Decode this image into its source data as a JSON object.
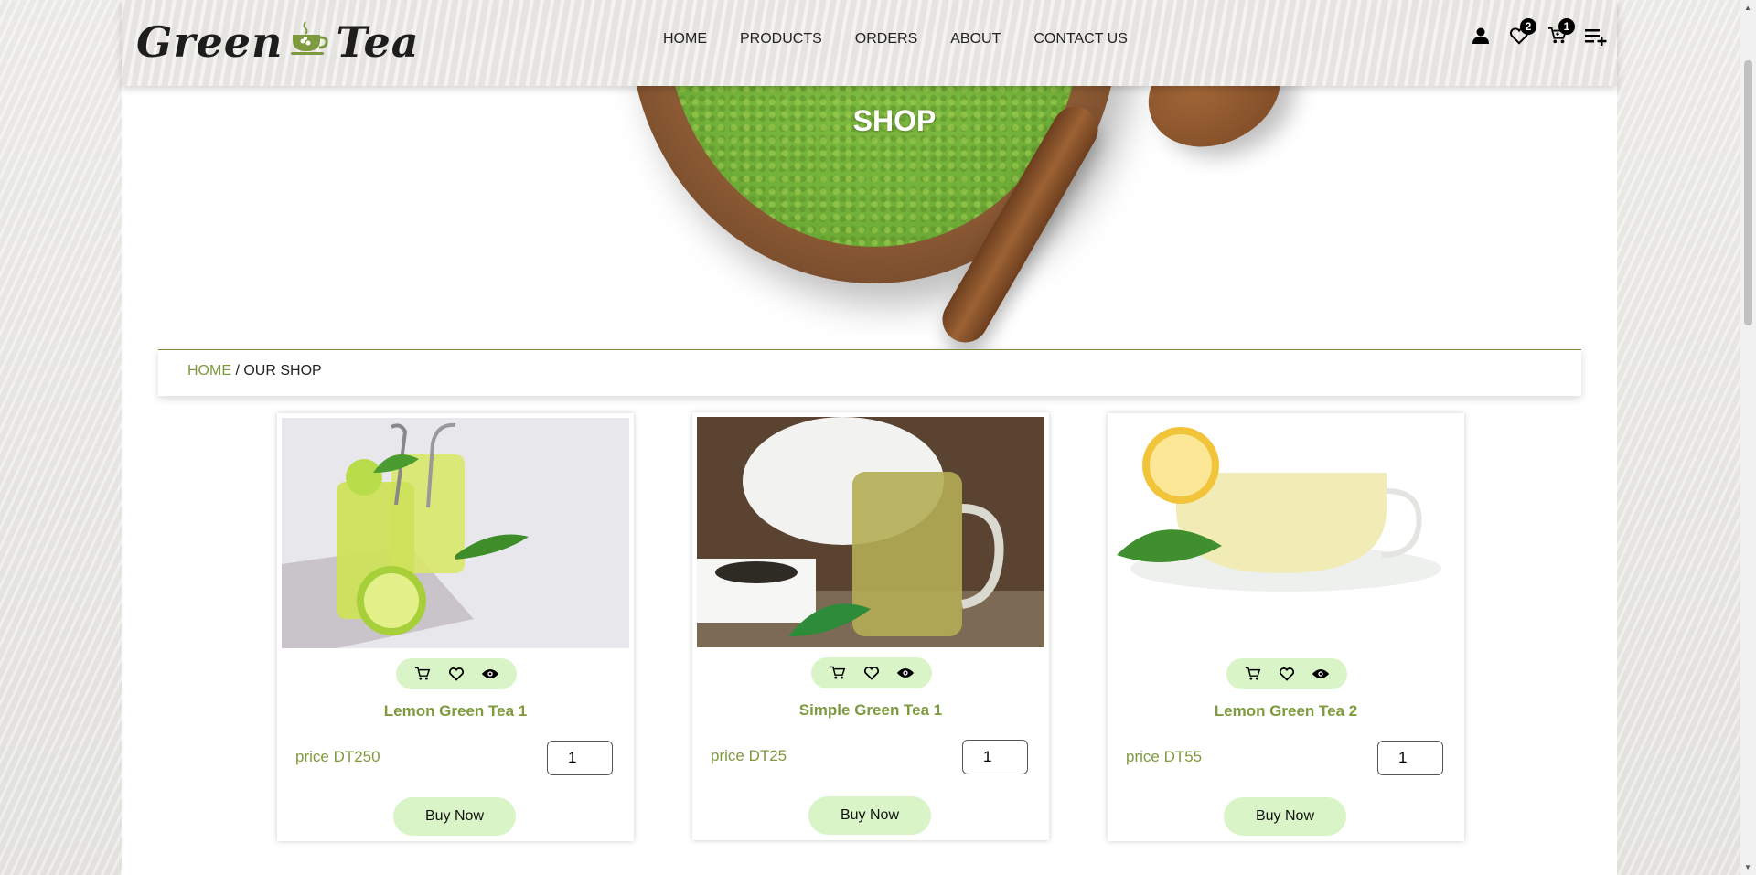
{
  "logo": {
    "text_left": "Green",
    "text_right": "Tea"
  },
  "nav": [
    {
      "label": "HOME"
    },
    {
      "label": "PRODUCTS"
    },
    {
      "label": "ORDERS"
    },
    {
      "label": "ABOUT"
    },
    {
      "label": "CONTACT US"
    }
  ],
  "header_icons": {
    "user": "user-icon",
    "wishlist": "heart-icon",
    "wishlist_count": "2",
    "cart": "cart-icon",
    "cart_count": "1",
    "menu": "playlist-add-icon"
  },
  "hero": {
    "title": "SHOP"
  },
  "breadcrumb": {
    "home": "HOME",
    "separator": " / ",
    "current": "OUR SHOP"
  },
  "products": [
    {
      "name": "Lemon Green Tea 1",
      "price": "price DT250",
      "qty": "1",
      "buy": "Buy Now"
    },
    {
      "name": "Simple Green Tea 1",
      "price": "price DT25",
      "qty": "1",
      "buy": "Buy Now"
    },
    {
      "name": "Lemon Green Tea 2",
      "price": "price DT55",
      "qty": "1",
      "buy": "Buy Now"
    }
  ],
  "colors": {
    "accent": "#7e9a3e",
    "button_bg": "#d9f5c8",
    "matcha": "#78b63d",
    "wood": "#8b5a34"
  }
}
